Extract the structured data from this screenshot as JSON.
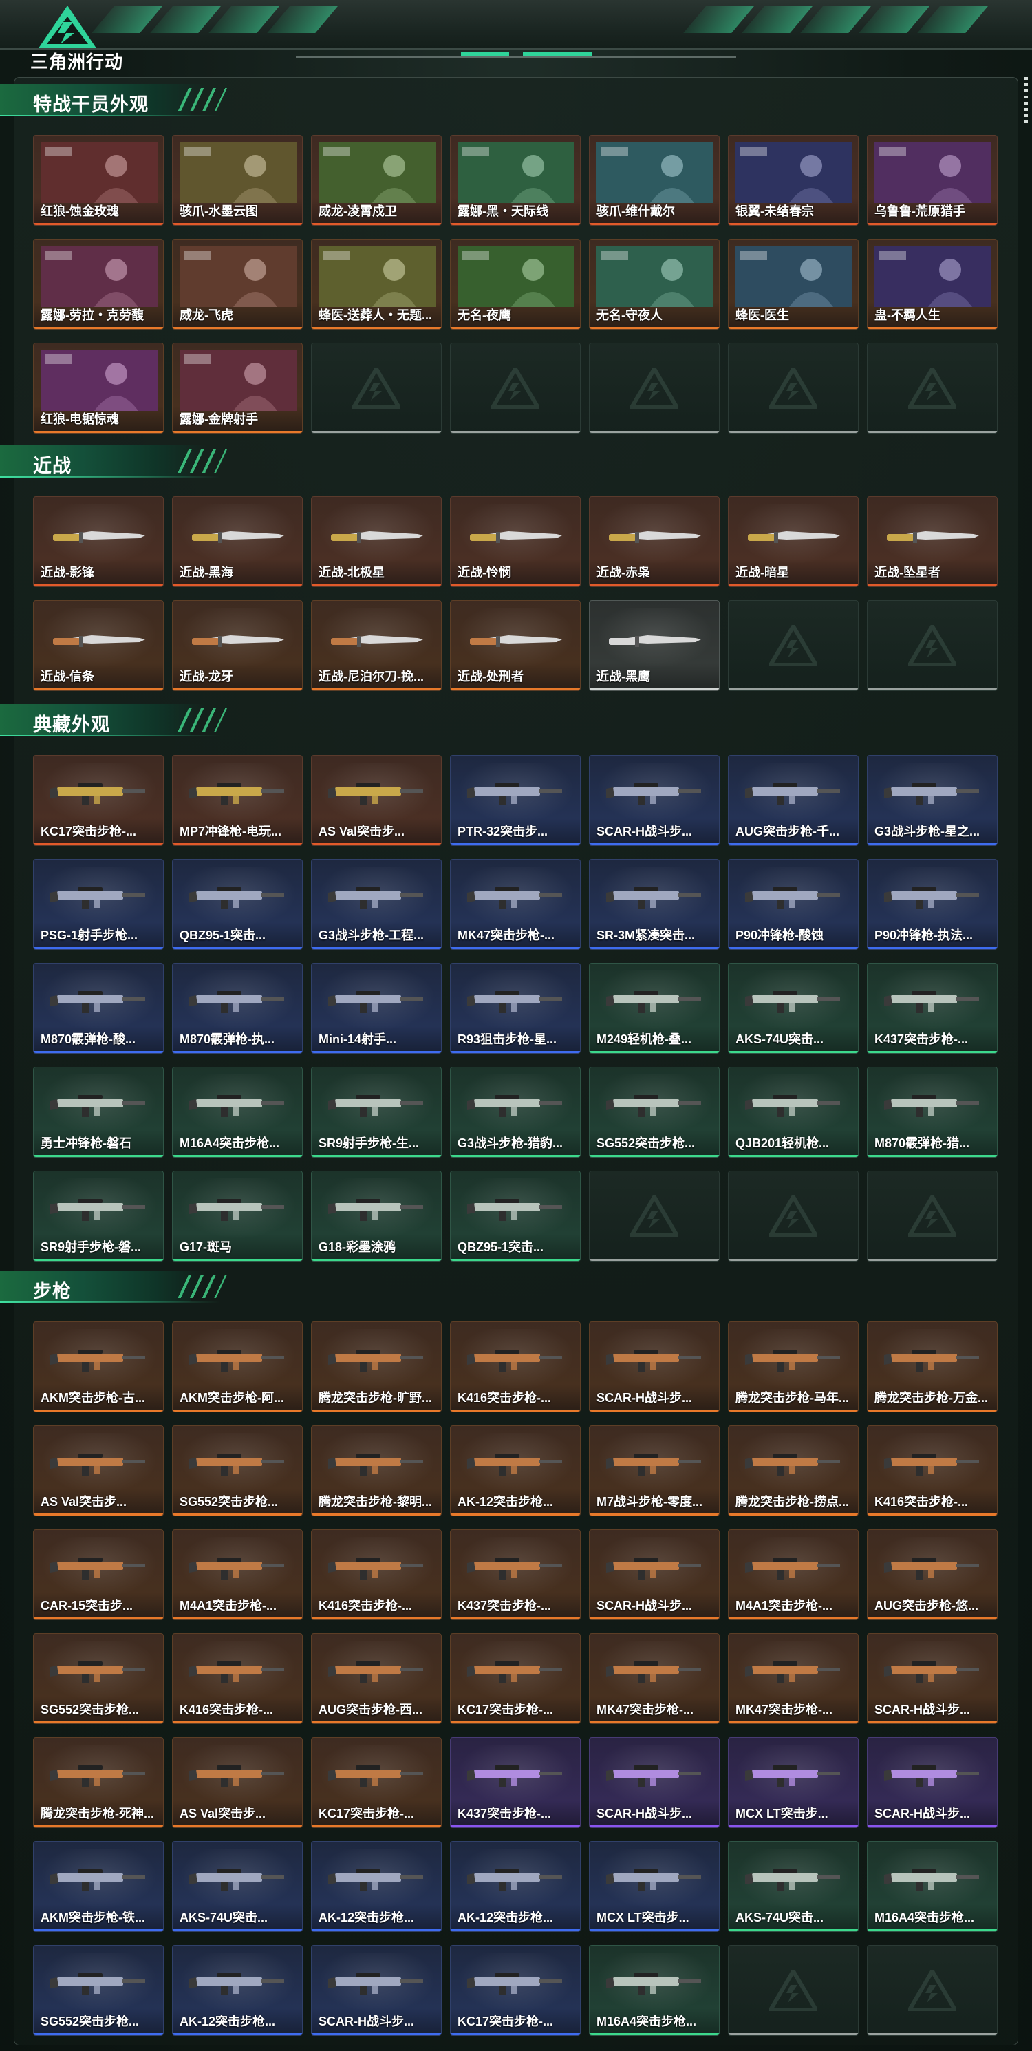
{
  "header": {
    "logo_text": "三角洲行动"
  },
  "colors": {
    "accent": "#3cd98c",
    "rarity_red": "#e25a2a",
    "rarity_orange": "#e8792a",
    "rarity_blue": "#3e6cf0",
    "rarity_green": "#3cd98c",
    "rarity_purple": "#8a55f0"
  },
  "sections": [
    {
      "title": "特战干员外观",
      "kind": "poster",
      "rows": 3,
      "items": [
        {
          "label": "红狼-蚀金玫瑰",
          "rarity": "red"
        },
        {
          "label": "骇爪-水墨云图",
          "rarity": "red"
        },
        {
          "label": "威龙-凌霄戍卫",
          "rarity": "red"
        },
        {
          "label": "露娜-黑・天际线",
          "rarity": "red"
        },
        {
          "label": "骇爪-维什戴尔",
          "rarity": "red"
        },
        {
          "label": "银翼-未结春宗",
          "rarity": "red"
        },
        {
          "label": "乌鲁鲁-荒原猎手",
          "rarity": "red"
        },
        {
          "label": "露娜-劳拉・克劳馥",
          "rarity": "orange"
        },
        {
          "label": "威龙-飞虎",
          "rarity": "orange"
        },
        {
          "label": "蜂医-送葬人・无题...",
          "rarity": "orange"
        },
        {
          "label": "无名-夜鹰",
          "rarity": "orange"
        },
        {
          "label": "无名-守夜人",
          "rarity": "orange"
        },
        {
          "label": "蜂医-医生",
          "rarity": "orange"
        },
        {
          "label": "蛊-不羁人生",
          "rarity": "orange"
        },
        {
          "label": "红狼-电锯惊魂",
          "rarity": "orange"
        },
        {
          "label": "露娜-金牌射手",
          "rarity": "orange"
        }
      ]
    },
    {
      "title": "近战",
      "kind": "knife",
      "rows": 2,
      "items": [
        {
          "label": "近战-影锋",
          "rarity": "red"
        },
        {
          "label": "近战-黑海",
          "rarity": "red"
        },
        {
          "label": "近战-北极星",
          "rarity": "red"
        },
        {
          "label": "近战-怜悯",
          "rarity": "red"
        },
        {
          "label": "近战-赤枭",
          "rarity": "red"
        },
        {
          "label": "近战-暗星",
          "rarity": "red"
        },
        {
          "label": "近战-坠星者",
          "rarity": "red"
        },
        {
          "label": "近战-信条",
          "rarity": "orange"
        },
        {
          "label": "近战-龙牙",
          "rarity": "orange"
        },
        {
          "label": "近战-尼泊尔刀-挽...",
          "rarity": "orange"
        },
        {
          "label": "近战-处刑者",
          "rarity": "orange"
        },
        {
          "label": "近战-黑鹰",
          "rarity": "white"
        }
      ]
    },
    {
      "title": "典藏外观",
      "kind": "gun",
      "rows": 5,
      "items": [
        {
          "label": "KC17突击步枪-...",
          "rarity": "red"
        },
        {
          "label": "MP7冲锋枪-电玩...",
          "rarity": "red"
        },
        {
          "label": "AS Val突击步...",
          "rarity": "red"
        },
        {
          "label": "PTR-32突击步...",
          "rarity": "blue"
        },
        {
          "label": "SCAR-H战斗步...",
          "rarity": "blue"
        },
        {
          "label": "AUG突击步枪-千...",
          "rarity": "blue"
        },
        {
          "label": "G3战斗步枪-星之...",
          "rarity": "blue"
        },
        {
          "label": "PSG-1射手步枪...",
          "rarity": "blue"
        },
        {
          "label": "QBZ95-1突击...",
          "rarity": "blue"
        },
        {
          "label": "G3战斗步枪-工程...",
          "rarity": "blue"
        },
        {
          "label": "MK47突击步枪-...",
          "rarity": "blue"
        },
        {
          "label": "SR-3M紧凑突击...",
          "rarity": "blue"
        },
        {
          "label": "P90冲锋枪-酸蚀",
          "rarity": "blue"
        },
        {
          "label": "P90冲锋枪-执法...",
          "rarity": "blue"
        },
        {
          "label": "M870霰弹枪-酸...",
          "rarity": "blue"
        },
        {
          "label": "M870霰弹枪-执...",
          "rarity": "blue"
        },
        {
          "label": "Mini-14射手...",
          "rarity": "blue"
        },
        {
          "label": "R93狙击步枪-星...",
          "rarity": "blue"
        },
        {
          "label": "M249轻机枪-叠...",
          "rarity": "green"
        },
        {
          "label": "AKS-74U突击...",
          "rarity": "green"
        },
        {
          "label": "K437突击步枪-...",
          "rarity": "green"
        },
        {
          "label": "勇士冲锋枪-磐石",
          "rarity": "green"
        },
        {
          "label": "M16A4突击步枪...",
          "rarity": "green"
        },
        {
          "label": "SR9射手步枪-生...",
          "rarity": "green"
        },
        {
          "label": "G3战斗步枪-猎豹...",
          "rarity": "green"
        },
        {
          "label": "SG552突击步枪...",
          "rarity": "green"
        },
        {
          "label": "QJB201轻机枪...",
          "rarity": "green"
        },
        {
          "label": "M870霰弹枪-猎...",
          "rarity": "green"
        },
        {
          "label": "SR9射手步枪-磐...",
          "rarity": "green"
        },
        {
          "label": "G17-斑马",
          "rarity": "green"
        },
        {
          "label": "G18-彩墨涂鸦",
          "rarity": "green"
        },
        {
          "label": "QBZ95-1突击...",
          "rarity": "green"
        }
      ]
    },
    {
      "title": "步枪",
      "kind": "gun",
      "rows": 7,
      "items": [
        {
          "label": "AKM突击步枪-古...",
          "rarity": "orange"
        },
        {
          "label": "AKM突击步枪-阿...",
          "rarity": "orange"
        },
        {
          "label": "腾龙突击步枪-旷野...",
          "rarity": "orange"
        },
        {
          "label": "K416突击步枪-...",
          "rarity": "orange"
        },
        {
          "label": "SCAR-H战斗步...",
          "rarity": "orange"
        },
        {
          "label": "腾龙突击步枪-马年...",
          "rarity": "orange"
        },
        {
          "label": "腾龙突击步枪-万金...",
          "rarity": "orange"
        },
        {
          "label": "AS Val突击步...",
          "rarity": "orange"
        },
        {
          "label": "SG552突击步枪...",
          "rarity": "orange"
        },
        {
          "label": "腾龙突击步枪-黎明...",
          "rarity": "orange"
        },
        {
          "label": "AK-12突击步枪...",
          "rarity": "orange"
        },
        {
          "label": "M7战斗步枪-零度...",
          "rarity": "orange"
        },
        {
          "label": "腾龙突击步枪-捞点...",
          "rarity": "orange"
        },
        {
          "label": "K416突击步枪-...",
          "rarity": "orange"
        },
        {
          "label": "CAR-15突击步...",
          "rarity": "orange"
        },
        {
          "label": "M4A1突击步枪-...",
          "rarity": "orange"
        },
        {
          "label": "K416突击步枪-...",
          "rarity": "orange"
        },
        {
          "label": "K437突击步枪-...",
          "rarity": "orange"
        },
        {
          "label": "SCAR-H战斗步...",
          "rarity": "orange"
        },
        {
          "label": "M4A1突击步枪-...",
          "rarity": "orange"
        },
        {
          "label": "AUG突击步枪-悠...",
          "rarity": "orange"
        },
        {
          "label": "SG552突击步枪...",
          "rarity": "orange"
        },
        {
          "label": "K416突击步枪-...",
          "rarity": "orange"
        },
        {
          "label": "AUG突击步枪-西...",
          "rarity": "orange"
        },
        {
          "label": "KC17突击步枪-...",
          "rarity": "orange"
        },
        {
          "label": "MK47突击步枪-...",
          "rarity": "orange"
        },
        {
          "label": "MK47突击步枪-...",
          "rarity": "orange"
        },
        {
          "label": "SCAR-H战斗步...",
          "rarity": "orange"
        },
        {
          "label": "腾龙突击步枪-死神...",
          "rarity": "orange"
        },
        {
          "label": "AS Val突击步...",
          "rarity": "orange"
        },
        {
          "label": "KC17突击步枪-...",
          "rarity": "orange"
        },
        {
          "label": "K437突击步枪-...",
          "rarity": "purple"
        },
        {
          "label": "SCAR-H战斗步...",
          "rarity": "purple"
        },
        {
          "label": "MCX LT突击步...",
          "rarity": "purple"
        },
        {
          "label": "SCAR-H战斗步...",
          "rarity": "purple"
        },
        {
          "label": "AKM突击步枪-铁...",
          "rarity": "blue"
        },
        {
          "label": "AKS-74U突击...",
          "rarity": "blue"
        },
        {
          "label": "AK-12突击步枪...",
          "rarity": "blue"
        },
        {
          "label": "AK-12突击步枪...",
          "rarity": "blue"
        },
        {
          "label": "MCX LT突击步...",
          "rarity": "blue"
        },
        {
          "label": "AKS-74U突击...",
          "rarity": "green"
        },
        {
          "label": "M16A4突击步枪...",
          "rarity": "green"
        },
        {
          "label": "SG552突击步枪...",
          "rarity": "blue"
        },
        {
          "label": "AK-12突击步枪...",
          "rarity": "blue"
        },
        {
          "label": "SCAR-H战斗步...",
          "rarity": "blue"
        },
        {
          "label": "KC17突击步枪-...",
          "rarity": "blue"
        },
        {
          "label": "M16A4突击步枪...",
          "rarity": "green"
        }
      ]
    }
  ]
}
